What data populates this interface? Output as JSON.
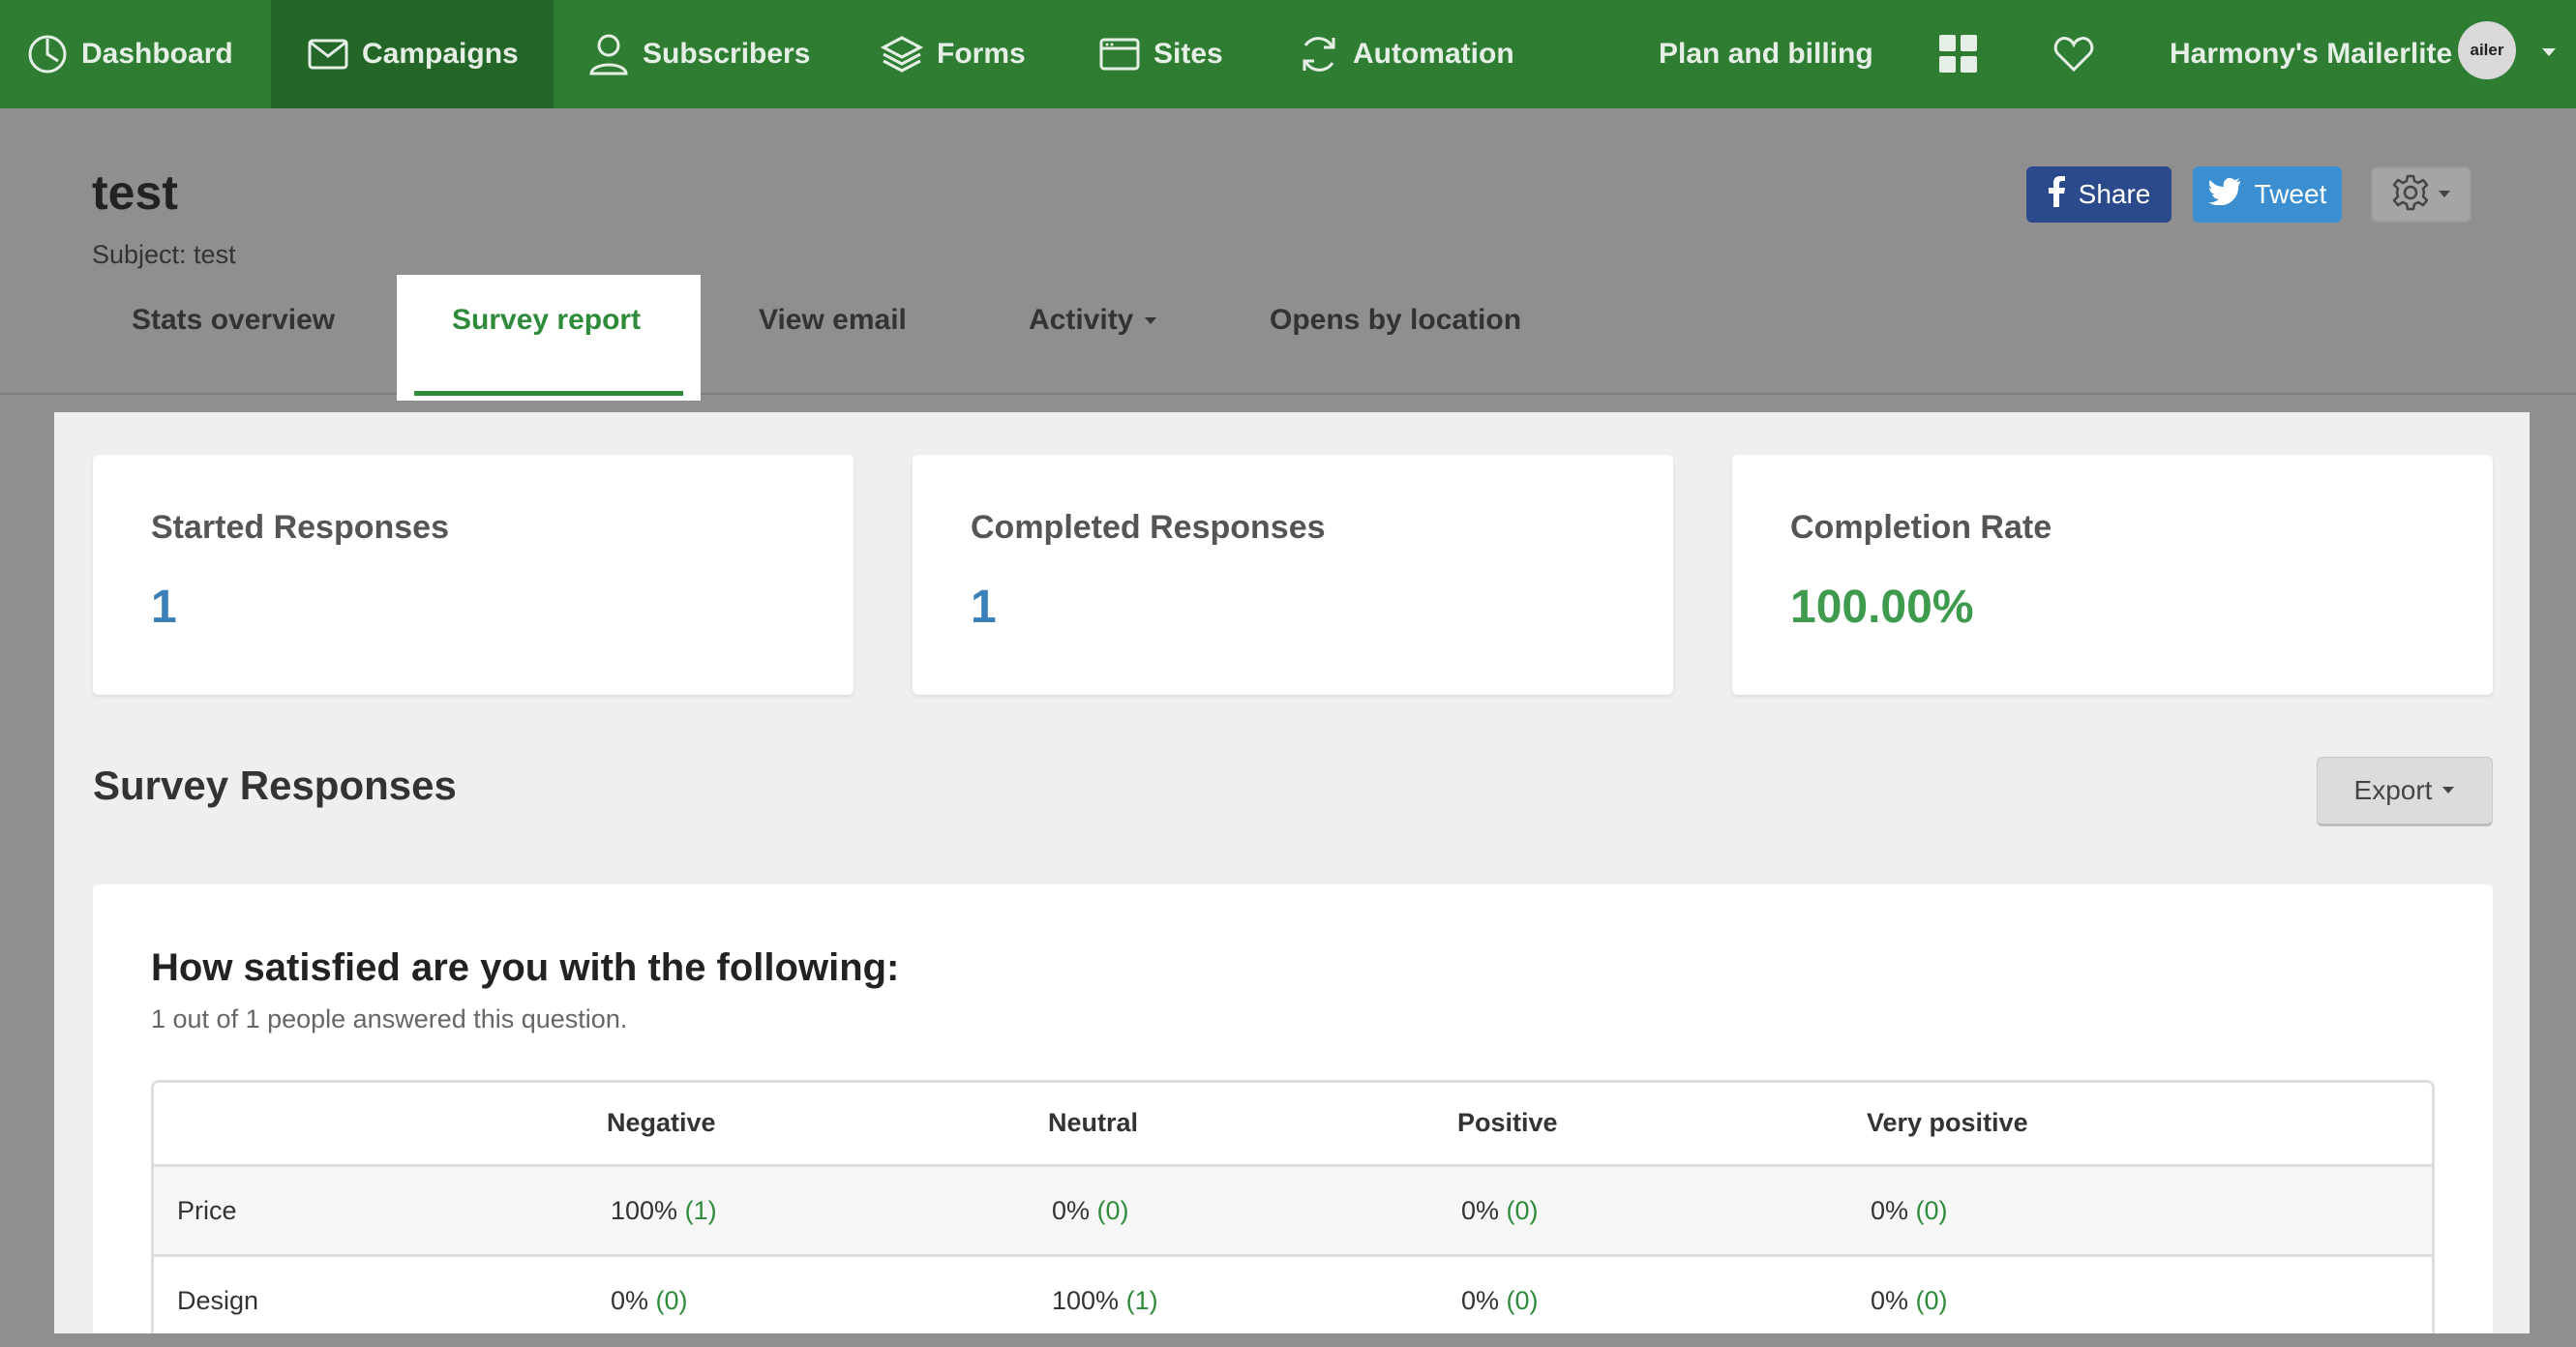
{
  "nav": {
    "items": [
      {
        "label": "Dashboard",
        "icon": "clock-icon"
      },
      {
        "label": "Campaigns",
        "icon": "envelope-icon"
      },
      {
        "label": "Subscribers",
        "icon": "user-icon"
      },
      {
        "label": "Forms",
        "icon": "layers-icon"
      },
      {
        "label": "Sites",
        "icon": "browser-window-icon"
      },
      {
        "label": "Automation",
        "icon": "refresh-icon"
      },
      {
        "label": "Plan and billing"
      },
      {
        "label": "Harmony's Mailerlite"
      }
    ],
    "apps_icon": "grid-icon",
    "favorites_icon": "heart-icon",
    "avatar_text": "ailer",
    "active_color": "#236627",
    "bar_color": "#2e7d32"
  },
  "header": {
    "title": "test",
    "subject": "Subject: test",
    "share_label": "Share",
    "tweet_label": "Tweet",
    "settings_icon": "gear-icon"
  },
  "tabs": [
    {
      "label": "Stats overview"
    },
    {
      "label": "Survey report",
      "active": true
    },
    {
      "label": "View email"
    },
    {
      "label": "Activity"
    },
    {
      "label": "Opens by location"
    }
  ],
  "stats": [
    {
      "label": "Started Responses",
      "value": "1",
      "color": "#3a7fb8"
    },
    {
      "label": "Completed Responses",
      "value": "1",
      "color": "#3a7fb8"
    },
    {
      "label": "Completion Rate",
      "value": "100.00%",
      "color": "#3e9a4d"
    }
  ],
  "survey": {
    "title": "Survey Responses",
    "export_label": "Export",
    "question": {
      "title": "How satisfied are you with the following:",
      "subtitle": "1 out of 1 people answered this question.",
      "columns": [
        "",
        "Negative",
        "Neutral",
        "Positive",
        "Very positive"
      ],
      "rows": [
        {
          "label": "Price",
          "cells": [
            {
              "pct": "100%",
              "count": "(1)"
            },
            {
              "pct": "0%",
              "count": "(0)"
            },
            {
              "pct": "0%",
              "count": "(0)"
            },
            {
              "pct": "0%",
              "count": "(0)"
            }
          ]
        },
        {
          "label": "Design",
          "cells": [
            {
              "pct": "0%",
              "count": "(0)"
            },
            {
              "pct": "100%",
              "count": "(1)"
            },
            {
              "pct": "0%",
              "count": "(0)"
            },
            {
              "pct": "0%",
              "count": "(0)"
            }
          ]
        }
      ]
    }
  }
}
